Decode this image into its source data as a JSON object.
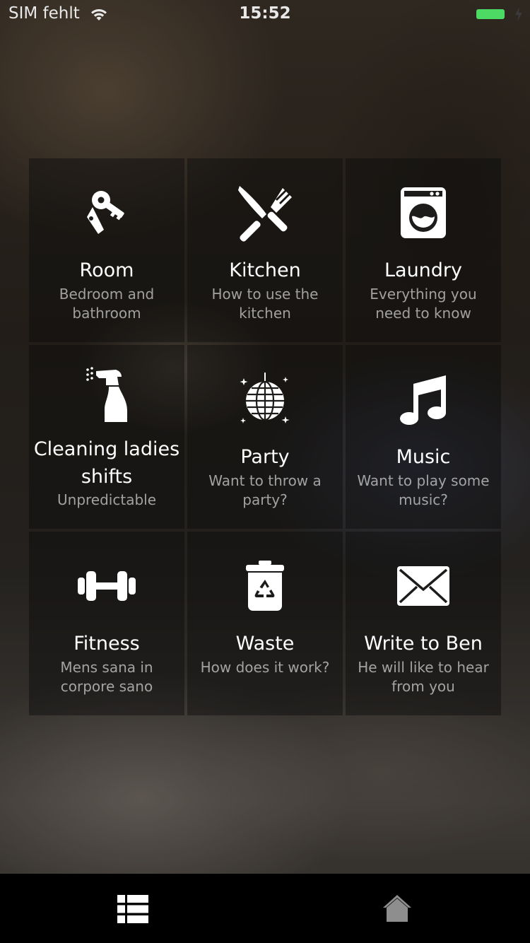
{
  "status_bar": {
    "carrier": "SIM fehlt",
    "time": "15:52",
    "battery_color": "#4cd964"
  },
  "tiles": [
    {
      "icon": "keys-icon",
      "title": "Room",
      "subtitle": "Bedroom and bathroom"
    },
    {
      "icon": "knife-fork-icon",
      "title": "Kitchen",
      "subtitle": "How to use the kitchen"
    },
    {
      "icon": "washing-machine-icon",
      "title": "Laundry",
      "subtitle": "Everything you need to know"
    },
    {
      "icon": "spray-bottle-icon",
      "title": "Cleaning ladies shifts",
      "subtitle": "Unpredictable"
    },
    {
      "icon": "disco-ball-icon",
      "title": "Party",
      "subtitle": "Want to throw a party?"
    },
    {
      "icon": "music-note-icon",
      "title": "Music",
      "subtitle": "Want to play some music?"
    },
    {
      "icon": "dumbbell-icon",
      "title": "Fitness",
      "subtitle": "Mens sana in corpore sano"
    },
    {
      "icon": "recycle-bin-icon",
      "title": "Waste",
      "subtitle": "How does it work?"
    },
    {
      "icon": "envelope-icon",
      "title": "Write to Ben",
      "subtitle": "He will like to hear from you"
    }
  ],
  "tab_bar": {
    "items": [
      {
        "icon": "list-icon",
        "selected": true,
        "color": "#ffffff"
      },
      {
        "icon": "home-icon",
        "selected": false,
        "color": "#8e8e8e"
      }
    ]
  }
}
